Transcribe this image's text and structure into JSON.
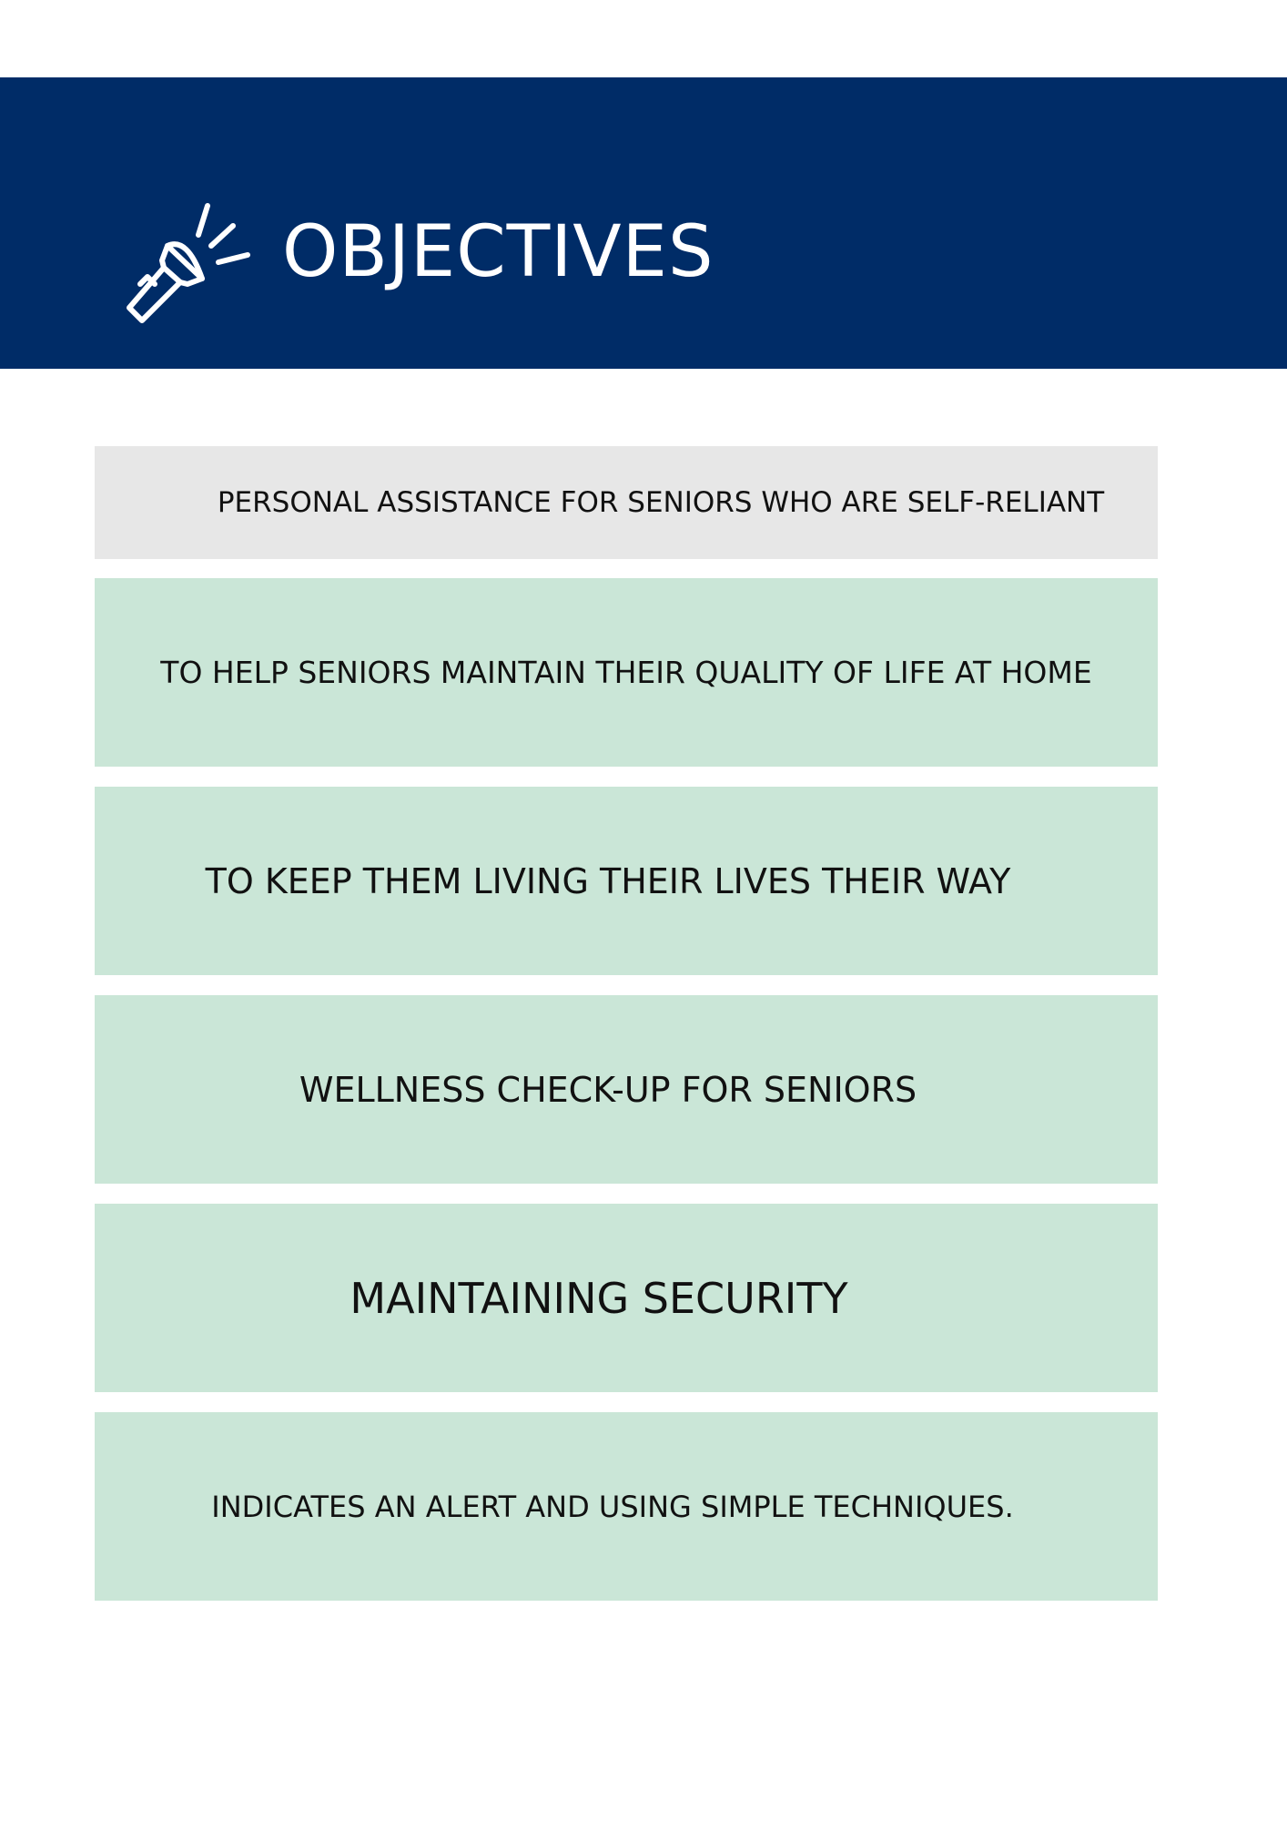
{
  "header": {
    "title": "OBJECTIVES",
    "icon": "flashlight-icon",
    "background_color": "#002c67"
  },
  "colors": {
    "grey_box": "#e7e7e7",
    "green_box": "#cae6d7",
    "text": "#111111"
  },
  "objectives": [
    "PERSONAL ASSISTANCE FOR SENIORS WHO ARE SELF-RELIANT",
    "TO HELP SENIORS MAINTAIN THEIR QUALITY OF LIFE AT HOME",
    "TO KEEP THEM LIVING THEIR LIVES THEIR WAY",
    "WELLNESS CHECK-UP FOR SENIORS",
    "MAINTAINING SECURITY",
    "INDICATES AN ALERT AND USING SIMPLE TECHNIQUES."
  ]
}
